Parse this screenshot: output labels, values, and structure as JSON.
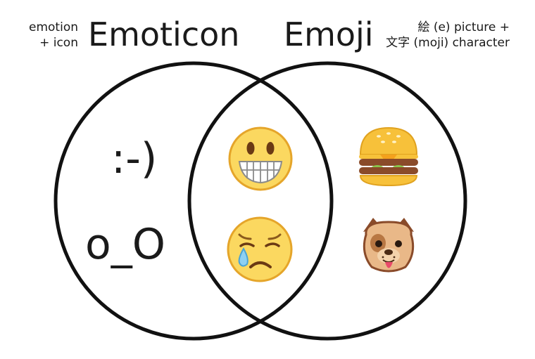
{
  "left_set": {
    "title": "Emoticon",
    "etymology": [
      "emotion",
      "+ icon"
    ]
  },
  "right_set": {
    "title": "Emoji",
    "etymology": [
      "絵 (e) picture +",
      "文字 (moji) character"
    ]
  },
  "left_only_items": [
    ":-)",
    "o_O"
  ],
  "intersection_items": [
    "grinning-face-icon",
    "sad-tear-face-icon"
  ],
  "right_only_items": [
    "hamburger-icon",
    "dog-face-icon"
  ],
  "colors": {
    "outline": "#111111",
    "face_fill": "#fbd860",
    "face_stroke": "#e5a52a",
    "bun": "#f7c13a",
    "patty": "#8a4b2a",
    "lettuce": "#8bc34a",
    "dog_fur": "#c98a52",
    "dog_face": "#e9b888"
  }
}
